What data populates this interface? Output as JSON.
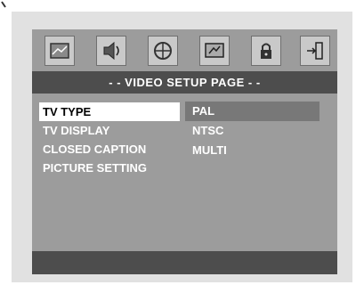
{
  "title": "- -  VIDEO SETUP PAGE  - -",
  "icons": [
    {
      "name": "general-setup-icon"
    },
    {
      "name": "audio-setup-icon"
    },
    {
      "name": "dolby-setup-icon"
    },
    {
      "name": "video-setup-icon"
    },
    {
      "name": "lock-icon"
    },
    {
      "name": "exit-icon"
    }
  ],
  "menu": [
    {
      "label": "TV TYPE",
      "selected": true
    },
    {
      "label": "TV DISPLAY",
      "selected": false
    },
    {
      "label": "CLOSED CAPTION",
      "selected": false
    },
    {
      "label": "PICTURE SETTING",
      "selected": false
    }
  ],
  "options": [
    {
      "label": "PAL",
      "selected": true
    },
    {
      "label": "NTSC",
      "selected": false
    },
    {
      "label": "MULTI",
      "selected": false
    }
  ]
}
